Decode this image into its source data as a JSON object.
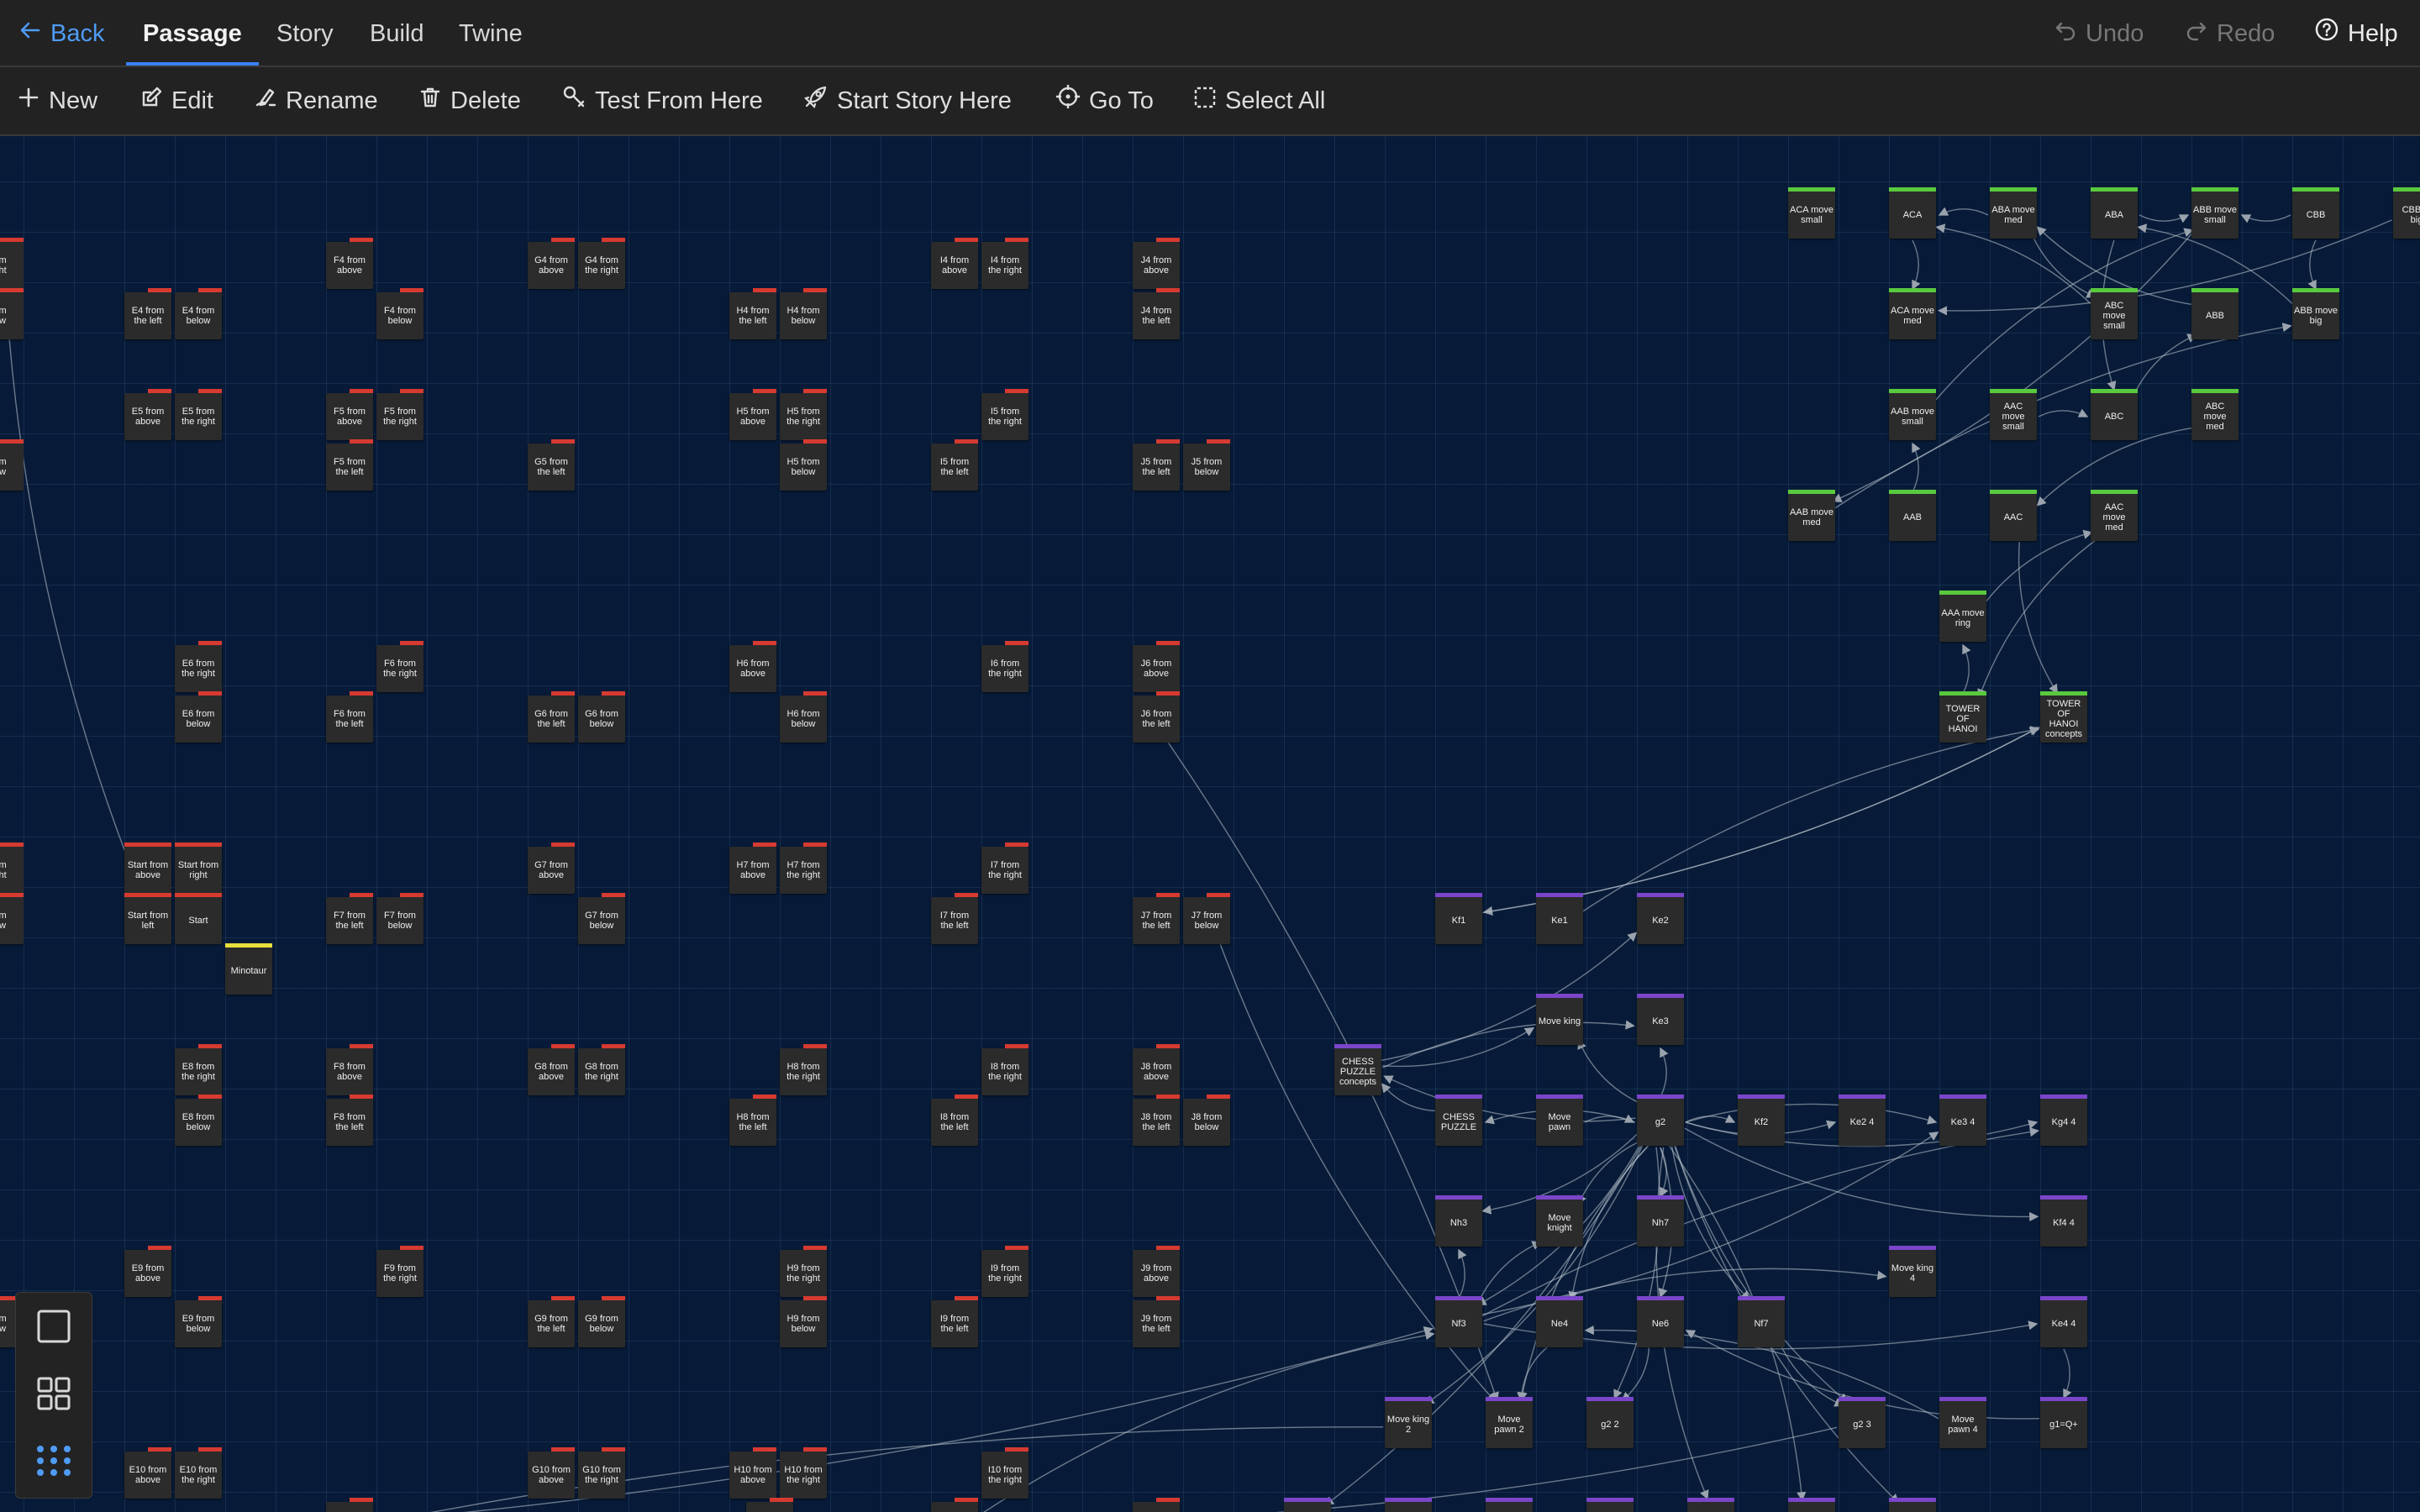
{
  "topbar": {
    "back_label": "Back",
    "tabs": [
      "Passage",
      "Story",
      "Build",
      "Twine"
    ],
    "undo_label": "Undo",
    "redo_label": "Redo",
    "help_label": "Help"
  },
  "toolbar": {
    "new_label": "New",
    "edit_label": "Edit",
    "rename_label": "Rename",
    "delete_label": "Delete",
    "test_label": "Test From Here",
    "start_label": "Start Story Here",
    "goto_label": "Go To",
    "select_all_label": "Select All"
  },
  "colors": {
    "accent": "#3b82f6",
    "tag_red": "#d63a30",
    "tag_green": "#5ac93e",
    "tag_purple": "#7a45c9",
    "tag_yellow": "#e6df3c"
  },
  "passages": [
    {
      "label": "om\nght",
      "tag": "red"
    },
    {
      "label": "F4 from\nabove",
      "tag": "red"
    },
    {
      "label": "G4 from\nabove",
      "tag": "red"
    },
    {
      "label": "G4 from\nthe right",
      "tag": "red"
    },
    {
      "label": "I4 from\nabove",
      "tag": "red"
    },
    {
      "label": "I4 from\nthe right",
      "tag": "red"
    },
    {
      "label": "J4 from\nabove",
      "tag": "red"
    },
    {
      "label": "om\now",
      "tag": "red"
    },
    {
      "label": "E4 from\nthe left",
      "tag": "red"
    },
    {
      "label": "E4 from\nbelow",
      "tag": "red"
    },
    {
      "label": "F4 from\nbelow",
      "tag": "red"
    },
    {
      "label": "H4 from\nthe left",
      "tag": "red"
    },
    {
      "label": "H4 from\nbelow",
      "tag": "red"
    },
    {
      "label": "J4 from\nthe left",
      "tag": "red"
    },
    {
      "label": "E5 from\nabove",
      "tag": "red"
    },
    {
      "label": "E5 from\nthe right",
      "tag": "red"
    },
    {
      "label": "F5 from\nabove",
      "tag": "red"
    },
    {
      "label": "F5 from\nthe right",
      "tag": "red"
    },
    {
      "label": "H5 from\nabove",
      "tag": "red"
    },
    {
      "label": "H5 from\nthe right",
      "tag": "red"
    },
    {
      "label": "I5 from\nthe right",
      "tag": "red"
    },
    {
      "label": "om\now",
      "tag": "red"
    },
    {
      "label": "F5 from\nthe left",
      "tag": "red"
    },
    {
      "label": "G5 from\nthe left",
      "tag": "red"
    },
    {
      "label": "H5 from\nbelow",
      "tag": "red"
    },
    {
      "label": "I5 from\nthe left",
      "tag": "red"
    },
    {
      "label": "J5 from\nthe left",
      "tag": "red"
    },
    {
      "label": "J5 from\nbelow",
      "tag": "red"
    },
    {
      "label": "E6 from\nthe right",
      "tag": "red"
    },
    {
      "label": "F6 from\nthe right",
      "tag": "red"
    },
    {
      "label": "H6 from\nabove",
      "tag": "red"
    },
    {
      "label": "I6 from\nthe right",
      "tag": "red"
    },
    {
      "label": "J6 from\nabove",
      "tag": "red"
    },
    {
      "label": "E6 from\nbelow",
      "tag": "red"
    },
    {
      "label": "F6 from\nthe left",
      "tag": "red"
    },
    {
      "label": "G6 from\nthe left",
      "tag": "red"
    },
    {
      "label": "G6 from\nbelow",
      "tag": "red"
    },
    {
      "label": "H6 from\nbelow",
      "tag": "red"
    },
    {
      "label": "J6 from\nthe left",
      "tag": "red"
    },
    {
      "label": "om\nght",
      "tag": "red"
    },
    {
      "label": "Start from\nabove",
      "tag": "redfull"
    },
    {
      "label": "Start from\nright",
      "tag": "redfull"
    },
    {
      "label": "G7 from\nabove",
      "tag": "red"
    },
    {
      "label": "H7 from\nabove",
      "tag": "red"
    },
    {
      "label": "H7 from\nthe right",
      "tag": "red"
    },
    {
      "label": "I7 from\nthe right",
      "tag": "red"
    },
    {
      "label": "om\now",
      "tag": "red"
    },
    {
      "label": "Start from\nleft",
      "tag": "redfull"
    },
    {
      "label": "Start",
      "tag": "redfull"
    },
    {
      "label": "F7 from\nthe left",
      "tag": "red"
    },
    {
      "label": "F7 from\nbelow",
      "tag": "red"
    },
    {
      "label": "G7 from\nbelow",
      "tag": "red"
    },
    {
      "label": "I7 from\nthe left",
      "tag": "red"
    },
    {
      "label": "J7 from\nthe left",
      "tag": "red"
    },
    {
      "label": "J7 from\nbelow",
      "tag": "red"
    },
    {
      "label": "Minotaur",
      "tag": "yellow"
    },
    {
      "label": "E8 from\nthe right",
      "tag": "red"
    },
    {
      "label": "F8 from\nabove",
      "tag": "red"
    },
    {
      "label": "G8 from\nabove",
      "tag": "red"
    },
    {
      "label": "G8 from\nthe right",
      "tag": "red"
    },
    {
      "label": "H8 from\nthe right",
      "tag": "red"
    },
    {
      "label": "I8 from\nthe right",
      "tag": "red"
    },
    {
      "label": "J8 from\nabove",
      "tag": "red"
    },
    {
      "label": "E8 from\nbelow",
      "tag": "red"
    },
    {
      "label": "F8 from\nthe left",
      "tag": "red"
    },
    {
      "label": "H8 from\nthe left",
      "tag": "red"
    },
    {
      "label": "I8 from\nthe left",
      "tag": "red"
    },
    {
      "label": "J8 from\nthe left",
      "tag": "red"
    },
    {
      "label": "J8 from\nbelow",
      "tag": "red"
    },
    {
      "label": "E9 from\nabove",
      "tag": "red"
    },
    {
      "label": "F9 from\nthe right",
      "tag": "red"
    },
    {
      "label": "H9 from\nthe right",
      "tag": "red"
    },
    {
      "label": "I9 from\nthe right",
      "tag": "red"
    },
    {
      "label": "J9 from\nabove",
      "tag": "red"
    },
    {
      "label": "om\now",
      "tag": "red"
    },
    {
      "label": "E9 from\nbelow",
      "tag": "red"
    },
    {
      "label": "G9 from\nthe left",
      "tag": "red"
    },
    {
      "label": "G9 from\nbelow",
      "tag": "red"
    },
    {
      "label": "H9 from\nbelow",
      "tag": "red"
    },
    {
      "label": "I9 from\nthe left",
      "tag": "red"
    },
    {
      "label": "J9 from\nthe left",
      "tag": "red"
    },
    {
      "label": "E10 from\nabove",
      "tag": "red"
    },
    {
      "label": "E10 from\nthe right",
      "tag": "red"
    },
    {
      "label": "G10 from\nabove",
      "tag": "red"
    },
    {
      "label": "G10 from\nthe right",
      "tag": "red"
    },
    {
      "label": "H10 from\nabove",
      "tag": "red"
    },
    {
      "label": "H10 from\nthe right",
      "tag": "red"
    },
    {
      "label": "I10 from\nthe right",
      "tag": "red"
    },
    {
      "label": "ACA move\nsmall",
      "tag": "green"
    },
    {
      "label": "ACA",
      "tag": "green"
    },
    {
      "label": "ABA move\nmed",
      "tag": "green"
    },
    {
      "label": "ABA",
      "tag": "green"
    },
    {
      "label": "ABB move\nsmall",
      "tag": "green"
    },
    {
      "label": "CBB",
      "tag": "green"
    },
    {
      "label": "CBB m\nbig",
      "tag": "green"
    },
    {
      "label": "ACA move\nmed",
      "tag": "green"
    },
    {
      "label": "ABC\nmove\nsmall",
      "tag": "green"
    },
    {
      "label": "ABB",
      "tag": "green"
    },
    {
      "label": "ABB move\nbig",
      "tag": "green"
    },
    {
      "label": "AAB move\nsmall",
      "tag": "green"
    },
    {
      "label": "AAC move\nsmall",
      "tag": "green"
    },
    {
      "label": "ABC",
      "tag": "green"
    },
    {
      "label": "ABC\nmove\nmed",
      "tag": "green"
    },
    {
      "label": "AAB move\nmed",
      "tag": "green"
    },
    {
      "label": "AAB",
      "tag": "green"
    },
    {
      "label": "AAC",
      "tag": "green"
    },
    {
      "label": "AAC move\nmed",
      "tag": "green"
    },
    {
      "label": "AAA move\nring",
      "tag": "green"
    },
    {
      "label": "TOWER\nOF HANOI",
      "tag": "green"
    },
    {
      "label": "TOWER\nOF HANOI\nconcepts",
      "tag": "green"
    },
    {
      "label": "Kf1",
      "tag": "purple"
    },
    {
      "label": "Ke1",
      "tag": "purple"
    },
    {
      "label": "Ke2",
      "tag": "purple"
    },
    {
      "label": "Move king",
      "tag": "purple"
    },
    {
      "label": "Ke3",
      "tag": "purple"
    },
    {
      "label": "CHESS\nPUZZLE\nconcepts",
      "tag": "purple"
    },
    {
      "label": "CHESS\nPUZZLE",
      "tag": "purple"
    },
    {
      "label": "Move\npawn",
      "tag": "purple"
    },
    {
      "label": "g2",
      "tag": "purple"
    },
    {
      "label": "Kf2",
      "tag": "purple"
    },
    {
      "label": "Ke2 4",
      "tag": "purple"
    },
    {
      "label": "Ke3 4",
      "tag": "purple"
    },
    {
      "label": "Kg4 4",
      "tag": "purple"
    },
    {
      "label": "Nh3",
      "tag": "purple"
    },
    {
      "label": "Move\nknight",
      "tag": "purple"
    },
    {
      "label": "Nh7",
      "tag": "purple"
    },
    {
      "label": "Kf4 4",
      "tag": "purple"
    },
    {
      "label": "Move king\n4",
      "tag": "purple"
    },
    {
      "label": "Nf3",
      "tag": "purple"
    },
    {
      "label": "Ne4",
      "tag": "purple"
    },
    {
      "label": "Ne6",
      "tag": "purple"
    },
    {
      "label": "Nf7",
      "tag": "purple"
    },
    {
      "label": "Ke4 4",
      "tag": "purple"
    },
    {
      "label": "Move king\n2",
      "tag": "purple"
    },
    {
      "label": "Move\npawn 2",
      "tag": "purple"
    },
    {
      "label": "g2 2",
      "tag": "purple"
    },
    {
      "label": "g2 3",
      "tag": "purple"
    },
    {
      "label": "Move\npawn 4",
      "tag": "purple"
    },
    {
      "label": "g1=Q+",
      "tag": "purple"
    },
    {
      "label": "",
      "tag": "red"
    },
    {
      "label": "",
      "tag": "red"
    },
    {
      "label": "",
      "tag": "red"
    },
    {
      "label": "",
      "tag": "red"
    },
    {
      "label": "",
      "tag": "purple"
    },
    {
      "label": "",
      "tag": "purple"
    },
    {
      "label": "",
      "tag": "purple"
    },
    {
      "label": "",
      "tag": "purple"
    },
    {
      "label": "",
      "tag": "purple"
    },
    {
      "label": "",
      "tag": "purple"
    },
    {
      "label": "",
      "tag": "purple"
    }
  ]
}
